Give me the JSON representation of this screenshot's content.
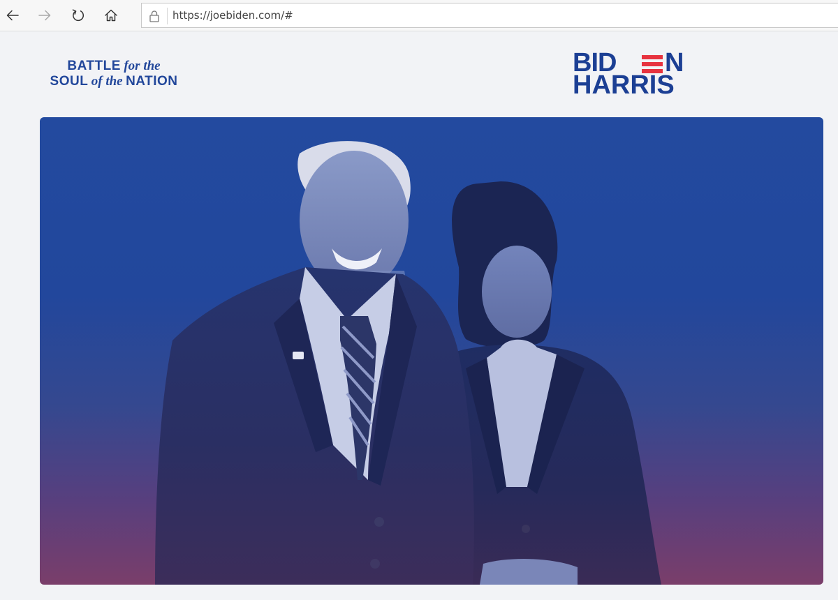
{
  "browser": {
    "url": "https://joebiden.com/#",
    "icons": [
      "back-arrow-icon",
      "forward-arrow-icon",
      "reload-icon",
      "home-icon",
      "lock-icon"
    ]
  },
  "header": {
    "left_logo": {
      "line1_bold": "BATTLE",
      "line1_italic": "for the",
      "line2_bold_a": "SOUL",
      "line2_italic": "of the",
      "line2_bold_b": "NATION"
    },
    "right_logo": {
      "line1_start": "BID",
      "line1_end": "N",
      "line2": "HARRIS"
    }
  },
  "hero": {
    "image": "biden-harris-portrait-photo"
  },
  "colors": {
    "brand_blue": "#1c3f94",
    "brand_red": "#e7333f",
    "hero_top": "#234a9f",
    "hero_bottom": "#7a3e6a",
    "page_background": "#f2f3f6"
  }
}
